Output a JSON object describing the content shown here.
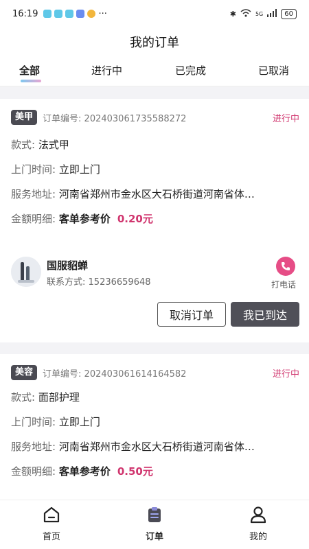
{
  "status_bar": {
    "time": "16:19",
    "more": "···",
    "network": "5G",
    "battery": "60"
  },
  "header": {
    "title": "我的订单"
  },
  "tabs": [
    {
      "label": "全部",
      "active": true
    },
    {
      "label": "进行中",
      "active": false
    },
    {
      "label": "已完成",
      "active": false
    },
    {
      "label": "已取消",
      "active": false
    }
  ],
  "orders": [
    {
      "type": "美甲",
      "order_no_label": "订单编号:",
      "order_no": "202403061735588272",
      "status": "进行中",
      "style_label": "款式:",
      "style": "法式甲",
      "time_label": "上门时间:",
      "time": "立即上门",
      "address_label": "服务地址:",
      "address": "河南省郑州市金水区大石桥街道河南省体…",
      "amount_label": "金额明细:",
      "amount_desc": "客单参考价",
      "amount": "0.20元",
      "contact": {
        "name": "国服貂蝉",
        "phone_label": "联系方式:",
        "phone": "15236659648",
        "call_label": "打电话"
      },
      "cancel_label": "取消订单",
      "arrive_label": "我已到达"
    },
    {
      "type": "美容",
      "order_no_label": "订单编号:",
      "order_no": "202403061614164582",
      "status": "进行中",
      "style_label": "款式:",
      "style": "面部护理",
      "time_label": "上门时间:",
      "time": "立即上门",
      "address_label": "服务地址:",
      "address": "河南省郑州市金水区大石桥街道河南省体…",
      "amount_label": "金额明细:",
      "amount_desc": "客单参考价",
      "amount": "0.50元"
    }
  ],
  "bottom_nav": [
    {
      "label": "首页",
      "icon": "home-icon",
      "active": false
    },
    {
      "label": "订单",
      "icon": "orders-icon",
      "active": true
    },
    {
      "label": "我的",
      "icon": "profile-icon",
      "active": false
    }
  ],
  "colors": {
    "accent": "#d0356e",
    "badge": "#4a4a52",
    "call": "#e64d86"
  }
}
